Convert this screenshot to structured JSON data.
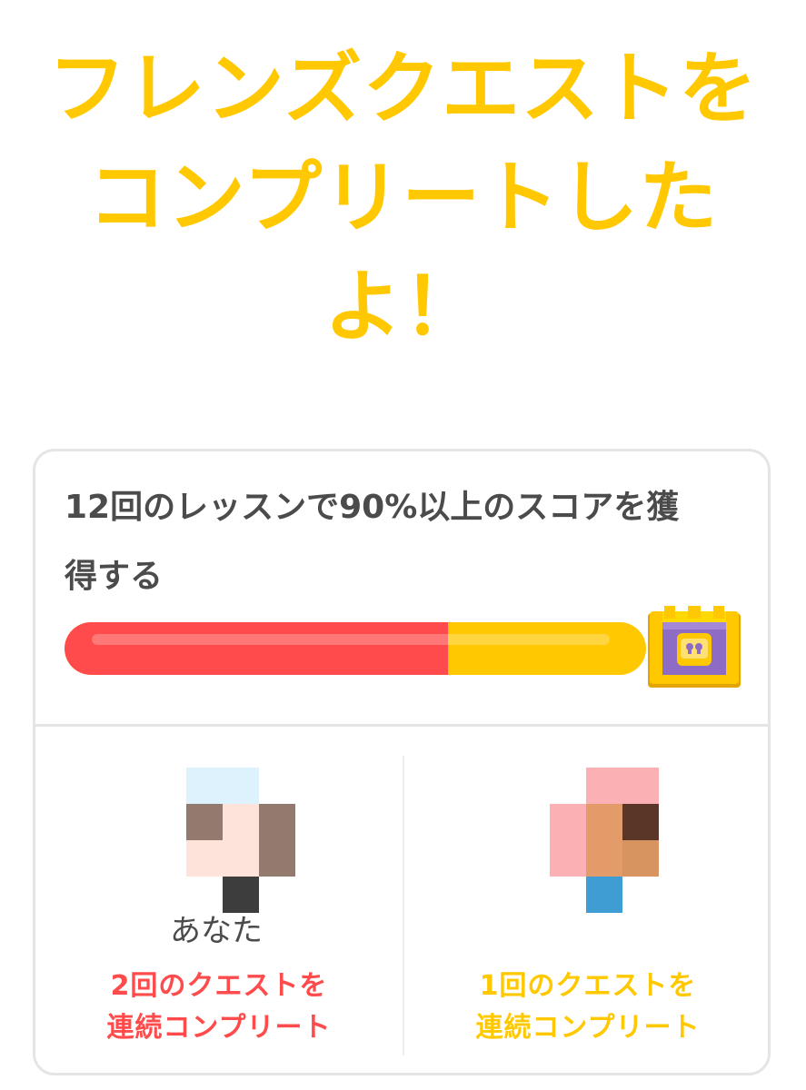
{
  "title": {
    "line1": "フレンズクエストを",
    "line2": "コンプリートした",
    "line3": "よ！"
  },
  "quest": {
    "description_line1": "12回のレッスンで90%以上のスコアを獲",
    "description_line2": "得する",
    "progress_fraction": 0.66,
    "reward_icon": "treasure-chest-icon"
  },
  "participants": [
    {
      "name": "あなた",
      "streak_line1": "2回のクエストを",
      "streak_line2": "連続コンプリート",
      "color": "#ff4b4b"
    },
    {
      "name": "",
      "streak_line1": "1回のクエストを",
      "streak_line2": "連続コンプリート",
      "color": "#ffc800"
    }
  ],
  "colors": {
    "title": "#ffc800",
    "progress_fill": "#ff4b4b",
    "progress_track": "#ffc800",
    "text": "#4b4b4b"
  }
}
